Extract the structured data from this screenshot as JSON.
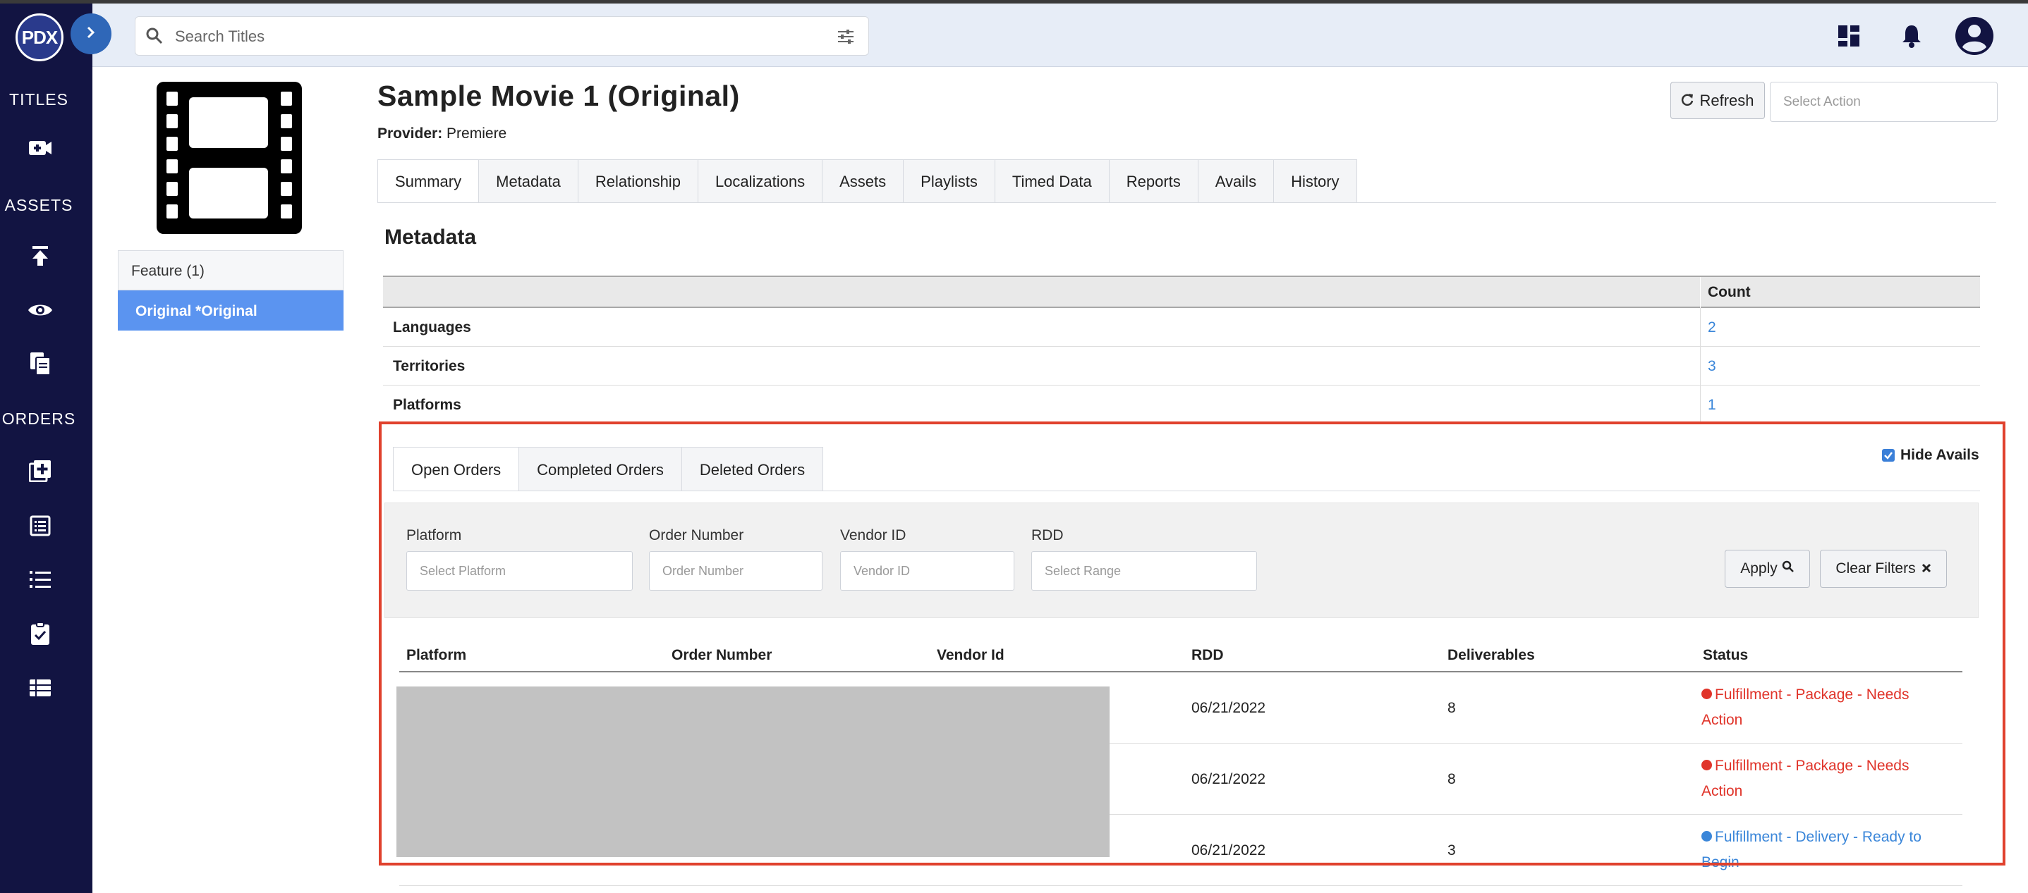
{
  "brand": {
    "logo_text": "PDX"
  },
  "sidebar": {
    "sections": [
      {
        "label": "TITLES"
      },
      {
        "label": "ASSETS"
      },
      {
        "label": "ORDERS"
      }
    ],
    "icons": [
      "add-title-icon",
      "upload-icon",
      "eye-icon",
      "copy-files-icon",
      "add-order-icon",
      "list-box-icon",
      "ordered-list-icon",
      "clipboard-check-icon",
      "table-list-icon"
    ]
  },
  "header": {
    "search_placeholder": "Search Titles",
    "icons": [
      "dashboard-icon",
      "bell-icon",
      "account-icon"
    ]
  },
  "title": {
    "name": "Sample Movie 1 (Original)",
    "provider_label": "Provider:",
    "provider_value": "Premiere",
    "refresh_label": "Refresh",
    "select_action_placeholder": "Select Action"
  },
  "side_list": [
    {
      "label": "Feature (1)"
    },
    {
      "label": "Original *Original"
    }
  ],
  "tabs": [
    "Summary",
    "Metadata",
    "Relationship",
    "Localizations",
    "Assets",
    "Playlists",
    "Timed Data",
    "Reports",
    "Avails",
    "History"
  ],
  "metadata": {
    "title": "Metadata",
    "count_header": "Count",
    "rows": [
      {
        "label": "Languages",
        "count": "2"
      },
      {
        "label": "Territories",
        "count": "3"
      },
      {
        "label": "Platforms",
        "count": "1"
      }
    ]
  },
  "orders": {
    "tabs": [
      "Open Orders",
      "Completed Orders",
      "Deleted Orders"
    ],
    "hide_avails_label": "Hide Avails",
    "hide_avails_checked": true,
    "filters": {
      "platform_label": "Platform",
      "platform_placeholder": "Select Platform",
      "order_number_label": "Order Number",
      "order_number_placeholder": "Order Number",
      "vendor_id_label": "Vendor ID",
      "vendor_id_placeholder": "Vendor ID",
      "rdd_label": "RDD",
      "rdd_placeholder": "Select Range",
      "apply_label": "Apply",
      "clear_label": "Clear Filters"
    },
    "columns": [
      "Platform",
      "Order Number",
      "Vendor Id",
      "RDD",
      "Deliverables",
      "Status"
    ],
    "rows": [
      {
        "rdd": "06/21/2022",
        "deliverables": "8",
        "status": "Fulfillment - Package - Needs Action",
        "status_color": "#e0342a"
      },
      {
        "rdd": "06/21/2022",
        "deliverables": "8",
        "status": "Fulfillment - Package - Needs Action",
        "status_color": "#e0342a"
      },
      {
        "rdd": "06/21/2022",
        "deliverables": "3",
        "status": "Fulfillment - Delivery - Ready to Begin",
        "status_color": "#3a86d9"
      }
    ]
  },
  "colors": {
    "sidebar_bg": "#121442",
    "header_bg": "#e7edf7",
    "active_item": "#5b94f0",
    "highlight_border": "#e0412d",
    "link": "#3a86d9"
  }
}
